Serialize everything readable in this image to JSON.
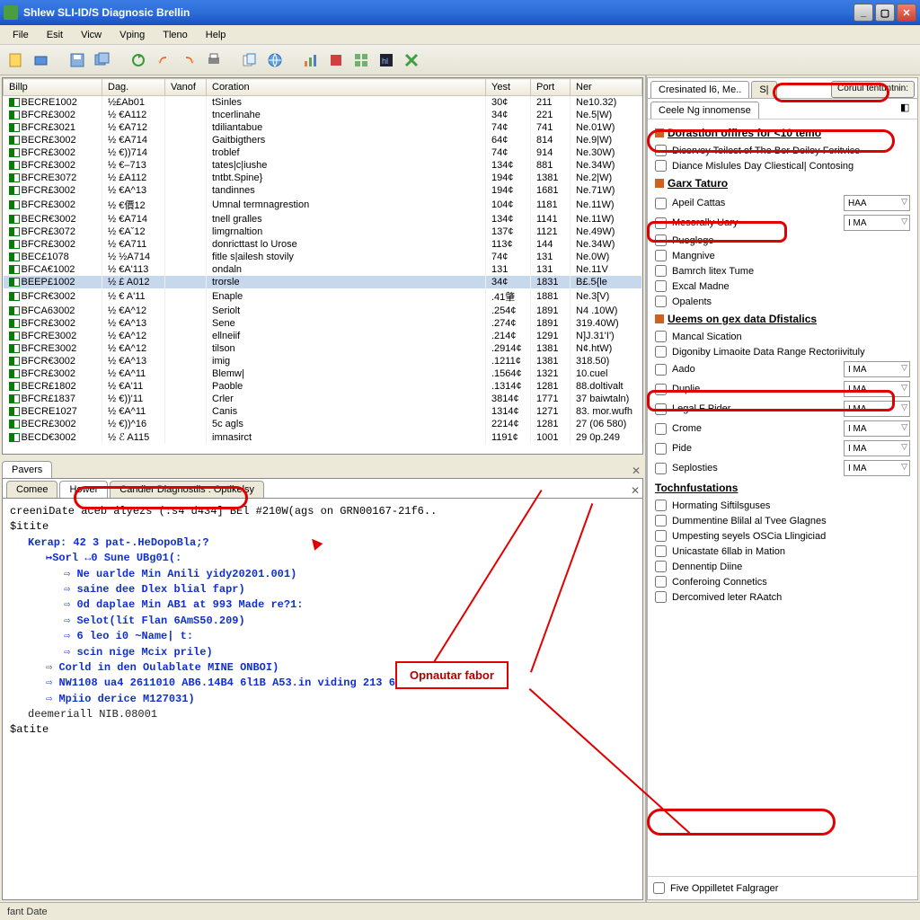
{
  "window": {
    "title": "Shlew SLI-ID/S Diagnosic Brellin"
  },
  "menu": [
    "File",
    "Esit",
    "Vicw",
    "Vping",
    "Tleno",
    "Help"
  ],
  "table": {
    "headers": [
      "Billp",
      "Dag.",
      "Vanof",
      "Coration",
      "Yest",
      "Port",
      "Ner"
    ],
    "rows": [
      {
        "c0": "BECRE1002",
        "c1": "½£Ab01",
        "c2": "",
        "c3": "tSinles",
        "c4": "30¢",
        "c5": "211",
        "c6": "Ne10.32)"
      },
      {
        "c0": "BFCR£3002",
        "c1": "½ €A112",
        "c2": "",
        "c3": "tncerlinahe",
        "c4": "34¢",
        "c5": "221",
        "c6": "Ne.5|W)"
      },
      {
        "c0": "BFCR£3021",
        "c1": "½ €A712",
        "c2": "",
        "c3": "tdiliantabue",
        "c4": "74¢",
        "c5": "741",
        "c6": "Ne.01W)"
      },
      {
        "c0": "BECR£3002",
        "c1": "½ €A714",
        "c2": "",
        "c3": "Gaitbigthers",
        "c4": "64¢",
        "c5": "814",
        "c6": "Ne.9|W)"
      },
      {
        "c0": "BFCR£3002",
        "c1": "½ €))714",
        "c2": "",
        "c3": "troblef",
        "c4": "74¢",
        "c5": "914",
        "c6": "Ne.30W)"
      },
      {
        "c0": "BFCR£3002",
        "c1": "½ €–713",
        "c2": "",
        "c3": "tates|c|iushe",
        "c4": "134¢",
        "c5": "881",
        "c6": "Ne.34W)"
      },
      {
        "c0": "BFCRE3072",
        "c1": "½ £A112",
        "c2": "",
        "c3": "tntbt.Spine}",
        "c4": "194¢",
        "c5": "1381",
        "c6": "Ne.2|W)"
      },
      {
        "c0": "BFCR£3002",
        "c1": "½ €A^13",
        "c2": "",
        "c3": "tandinnes",
        "c4": "194¢",
        "c5": "1681",
        "c6": "Ne.71W)"
      },
      {
        "c0": "BFCR£3002",
        "c1": "½ €價12",
        "c2": "",
        "c3": "Umnal termnagrestion",
        "c4": "104¢",
        "c5": "1181",
        "c6": "Ne.11W)"
      },
      {
        "c0": "BECR€3002",
        "c1": "½ €A714",
        "c2": "",
        "c3": "tnell gralles",
        "c4": "134¢",
        "c5": "1141",
        "c6": "Ne.11W)"
      },
      {
        "c0": "BFCR£3072",
        "c1": "½ €Aˇ12",
        "c2": "",
        "c3": "limgrnaltion",
        "c4": "137¢",
        "c5": "1121",
        "c6": "Ne.49W)"
      },
      {
        "c0": "BFCR£3002",
        "c1": "½ €A711",
        "c2": "",
        "c3": "donricttast lo Urose",
        "c4": "113¢",
        "c5": "144",
        "c6": "Ne.34W)"
      },
      {
        "c0": "BEC£1078",
        "c1": "½ ½A714",
        "c2": "",
        "c3": "fitle s|ailesh stovily",
        "c4": "74¢",
        "c5": "131",
        "c6": "Ne.0W)"
      },
      {
        "c0": "BFCA€1002",
        "c1": "½ €A'113",
        "c2": "",
        "c3": "ondaln",
        "c4": "131",
        "c5": "131",
        "c6": "Ne.11V"
      },
      {
        "c0": "BEEP£1002",
        "c1": "½ £ A012",
        "c2": "",
        "c3": "trorsle",
        "c4": "34¢",
        "c5": "1831",
        "c6": "B£.5{le",
        "sel": true
      },
      {
        "c0": "BFCR€3002",
        "c1": "½ € A'11",
        "c2": "",
        "c3": "Enaple",
        "c4": ".41肇",
        "c5": "1881",
        "c6": "Ne.3[V)"
      },
      {
        "c0": "BFCA63002",
        "c1": "½ €A^12",
        "c2": "",
        "c3": "Seriolt",
        "c4": ".254¢",
        "c5": "1891",
        "c6": "N4 .10W)"
      },
      {
        "c0": "BFCR£3002",
        "c1": "½ €A^13",
        "c2": "",
        "c3": "Sene",
        "c4": ".274¢",
        "c5": "1891",
        "c6": "319.40W)"
      },
      {
        "c0": "BFCRE3002",
        "c1": "½ €A^12",
        "c2": "",
        "c3": "ellneiif",
        "c4": ".214¢",
        "c5": "1291",
        "c6": "N]J.31'I')"
      },
      {
        "c0": "BFCRE3002",
        "c1": "½ €A^12",
        "c2": "",
        "c3": "tilson",
        "c4": ".2914¢",
        "c5": "1381",
        "c6": "N¢.htW)"
      },
      {
        "c0": "BFCR€3002",
        "c1": "½ €A^13",
        "c2": "",
        "c3": "imig",
        "c4": ".1211¢",
        "c5": "1381",
        "c6": "318.50)"
      },
      {
        "c0": "BFCR£3002",
        "c1": "½ €A^11",
        "c2": "",
        "c3": "Blemw|",
        "c4": ".1564¢",
        "c5": "1321",
        "c6": "10.cuel"
      },
      {
        "c0": "BECR£1802",
        "c1": "½ €A'11",
        "c2": "",
        "c3": "Paoble",
        "c4": ".1314¢",
        "c5": "1281",
        "c6": "88.doltivalt"
      },
      {
        "c0": "BFCR£1837",
        "c1": "½ €))'11",
        "c2": "",
        "c3": "Crler",
        "c4": "3814¢",
        "c5": "1771",
        "c6": "37 baiwtaln)"
      },
      {
        "c0": "BECRE1027",
        "c1": "½ €A^11",
        "c2": "",
        "c3": "Canis",
        "c4": "1314¢",
        "c5": "1271",
        "c6": "83. mor.wufh"
      },
      {
        "c0": "BECR£3002",
        "c1": "½ €))^16",
        "c2": "",
        "c3": "5c agls",
        "c4": "2214¢",
        "c5": "1281",
        "c6": "27 (06 580)"
      },
      {
        "c0": "BECD€3002",
        "c1": "½ ℰ A115",
        "c2": "",
        "c3": "imnasirct",
        "c4": "1191¢",
        "c5": "1001",
        "c6": "29 0p.249"
      }
    ]
  },
  "bottom": {
    "tab1": "Pavers",
    "subtabs": [
      "Comee",
      "Hower",
      "Candler Diagnostils : Optikelsy"
    ],
    "lines": [
      {
        "cls": "",
        "txt": "creeniDate aceb ályezs (:s4 d434] BEl #210W(ags on GRN00167-21f6.."
      },
      {
        "cls": "",
        "txt": "$itite"
      },
      {
        "cls": "indent1 kw",
        "txt": "Kerap: 42 3 pat-.HeDopoBla;?"
      },
      {
        "cls": "indent2 kw",
        "txt": "↦Sorl ↔0 Sune  UBg01(:"
      },
      {
        "cls": "indent3",
        "arrow": "⇨",
        "kw": "Ne uarlde Min Anili yidy20201.001)"
      },
      {
        "cls": "indent3",
        "arrow": "⇨",
        "kw": "saine dee Dlex blial fapr)"
      },
      {
        "cls": "indent3",
        "arrow": "⇨",
        "kw": "0d daplae Min AB1 at 993 Made re?1:"
      },
      {
        "cls": "indent3",
        "arrow": "⇨",
        "kw": "Selot(lít Flan  6AmS50.209)"
      },
      {
        "cls": "indent3",
        "arrow": "⇨",
        "kw": "6 leo i0   ~Name| t:"
      },
      {
        "cls": "indent3",
        "arrow": "⇨",
        "kw": "scin nige Mcix prile)"
      },
      {
        "cls": "indent2",
        "arrow": "⇨",
        "kw": "Corld in den Oulablate MINE ONBOI)"
      },
      {
        "cls": "indent2",
        "arrow": "⇨",
        "kw": "NW1108  ua4  2611010 AB6.14B4 6l1B A53.in viding 213 6B6300977{4C"
      },
      {
        "cls": "indent2",
        "arrow": "⇨",
        "kw": "Mpiio  derice  M127031)"
      },
      {
        "cls": "indent1 at",
        "txt": "deemeriall NIB.08001"
      },
      {
        "cls": "",
        "txt": "$atite"
      }
    ]
  },
  "right": {
    "maintabs": [
      "Cresinated l6, Me..",
      "S|",
      "Coruul tentuntnin:"
    ],
    "secondtab": "Ceele Ng innomense",
    "group1": "Dorastion offires for <10 temo",
    "g1_items": [
      "Dicervey Toilest of The Ber Deiloy Feritvice",
      "Diance Mislules Day Cliestical|  Contosing"
    ],
    "group2": "Garx Taturo",
    "g2_items": [
      {
        "label": "Apeil Cattas",
        "combo": "HAA"
      },
      {
        "label": "Mesorally Uary",
        "combo": "I MA"
      },
      {
        "label": "Puegloge"
      },
      {
        "label": "Mangnive"
      },
      {
        "label": "Bamrch litex Tume"
      },
      {
        "label": "Excal Madne"
      },
      {
        "label": "Opalents"
      }
    ],
    "group3": "Ueems on gex data Dfistalics",
    "g3_items": [
      {
        "label": "Mancal Sication"
      },
      {
        "label": "Digoniby Limaoite Data Range Rectoriivituly"
      },
      {
        "label": "Aado",
        "combo": "I MA"
      },
      {
        "label": "Duplie",
        "combo": "I MA"
      },
      {
        "label": "Legal F Pider",
        "combo": "I MA"
      },
      {
        "label": "Crome",
        "combo": "I MA"
      },
      {
        "label": "Pide",
        "combo": "I MA"
      },
      {
        "label": "Seplosties",
        "combo": "I MA"
      }
    ],
    "group4": "Tochnfustations",
    "g4_items": [
      "Hormating Siftilsguses",
      "Dummentine Blilal al Tvee Glagnes",
      "Umpesting seyels OSCia Llingiciad",
      "Unicastate 6llab in Mation",
      "Dennentip Diine",
      "Conferoing Connetics",
      "Dercomived leter RAatch"
    ],
    "bottom_check": "Five Oppilletet Falgrager"
  },
  "annotations": {
    "callout": "Opnautar fabor"
  },
  "status": "fant Date"
}
